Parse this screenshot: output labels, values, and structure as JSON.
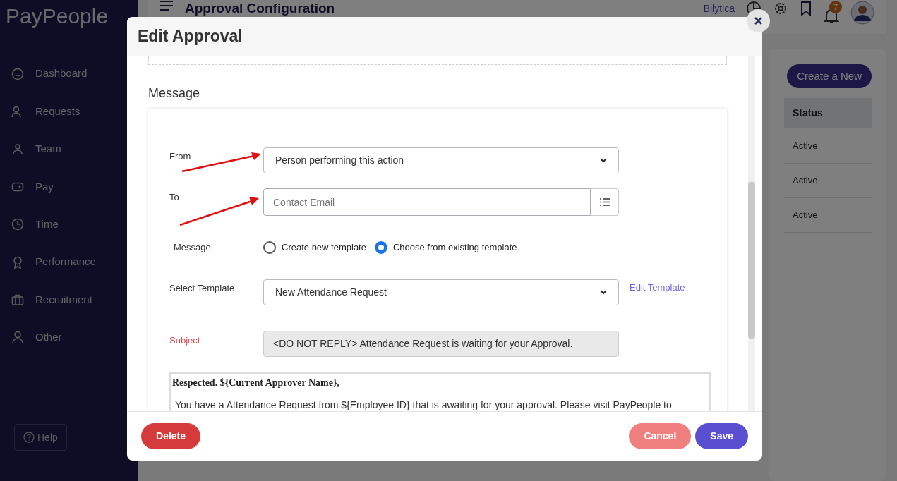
{
  "app": {
    "logo": "PayPeople"
  },
  "sidebar": {
    "items": [
      {
        "label": "Dashboard"
      },
      {
        "label": "Requests"
      },
      {
        "label": "Team"
      },
      {
        "label": "Pay"
      },
      {
        "label": "Time"
      },
      {
        "label": "Performance"
      },
      {
        "label": "Recruitment"
      },
      {
        "label": "Other"
      }
    ],
    "help": "Help"
  },
  "header": {
    "title": "Approval Configuration",
    "company": "Bilytica",
    "notification_count": "7"
  },
  "background_panel": {
    "create_button": "Create a New",
    "table": {
      "columns": [
        "Status"
      ],
      "rows": [
        [
          "Active"
        ],
        [
          "Active"
        ],
        [
          "Active"
        ]
      ]
    }
  },
  "modal": {
    "title": "Edit Approval",
    "section_title": "Message",
    "form": {
      "from": {
        "label": "From",
        "value": "Person performing this action"
      },
      "to": {
        "label": "To",
        "placeholder": "Contact Email"
      },
      "message": {
        "label": "Message",
        "options": [
          {
            "label": "Create new template",
            "selected": false
          },
          {
            "label": "Choose from existing template",
            "selected": true
          }
        ]
      },
      "template": {
        "label": "Select Template",
        "value": "New Attendance Request",
        "link": "Edit Template"
      },
      "subject": {
        "label": "Subject",
        "value": "<DO NOT REPLY> Attendance Request is waiting for your Approval."
      },
      "body": {
        "greeting": "Respected. ${Current Approver Name},",
        "text": "You have a Attendance Request from ${Employee ID} that is awaiting for your approval. Please visit PayPeople to"
      }
    },
    "buttons": [
      {
        "label": "Delete",
        "kind": "danger"
      },
      {
        "label": "Cancel",
        "kind": "secondary"
      },
      {
        "label": "Save",
        "kind": "primary"
      }
    ]
  }
}
